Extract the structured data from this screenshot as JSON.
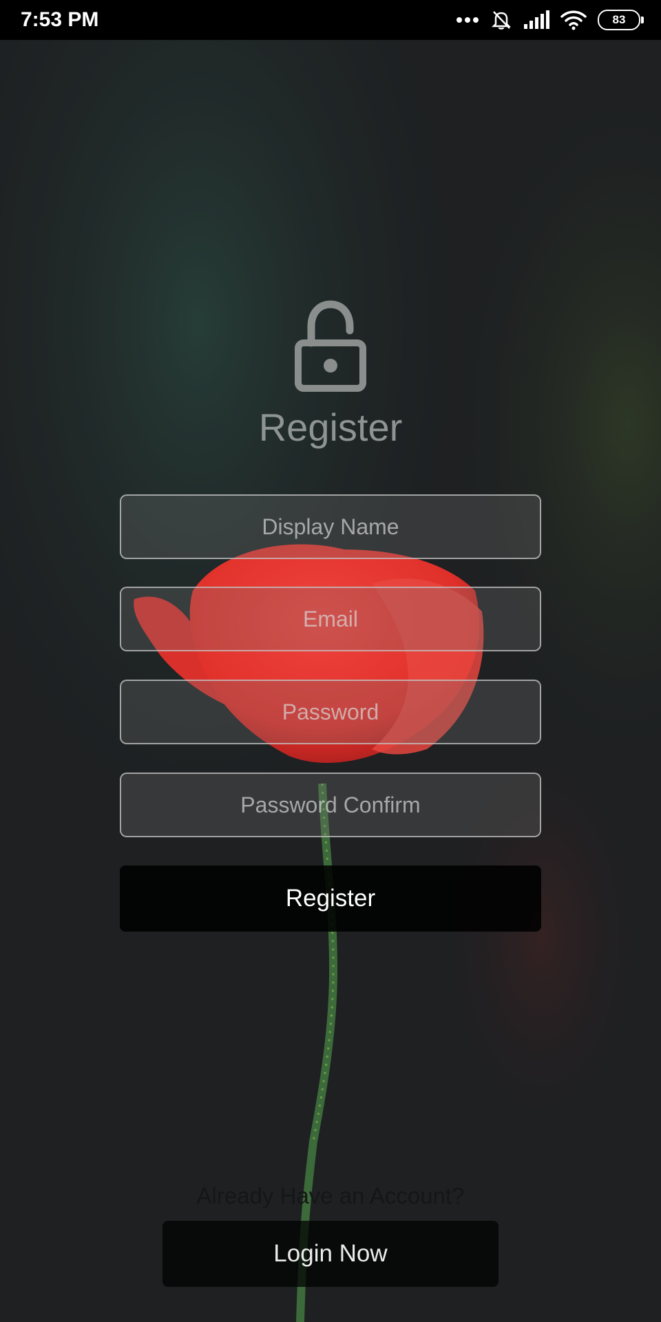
{
  "status_bar": {
    "time": "7:53 PM",
    "battery": "83",
    "icons": [
      "more-dots-icon",
      "bell-off-icon",
      "signal-icon",
      "wifi-icon",
      "battery-icon"
    ]
  },
  "header": {
    "icon": "lock-open-icon",
    "title": "Register"
  },
  "form": {
    "display_name_placeholder": "Display Name",
    "email_placeholder": "Email",
    "password_placeholder": "Password",
    "password_confirm_placeholder": "Password Confirm",
    "register_button": "Register"
  },
  "footer": {
    "account_text": "Already Have an Account?",
    "login_button": "Login Now"
  }
}
